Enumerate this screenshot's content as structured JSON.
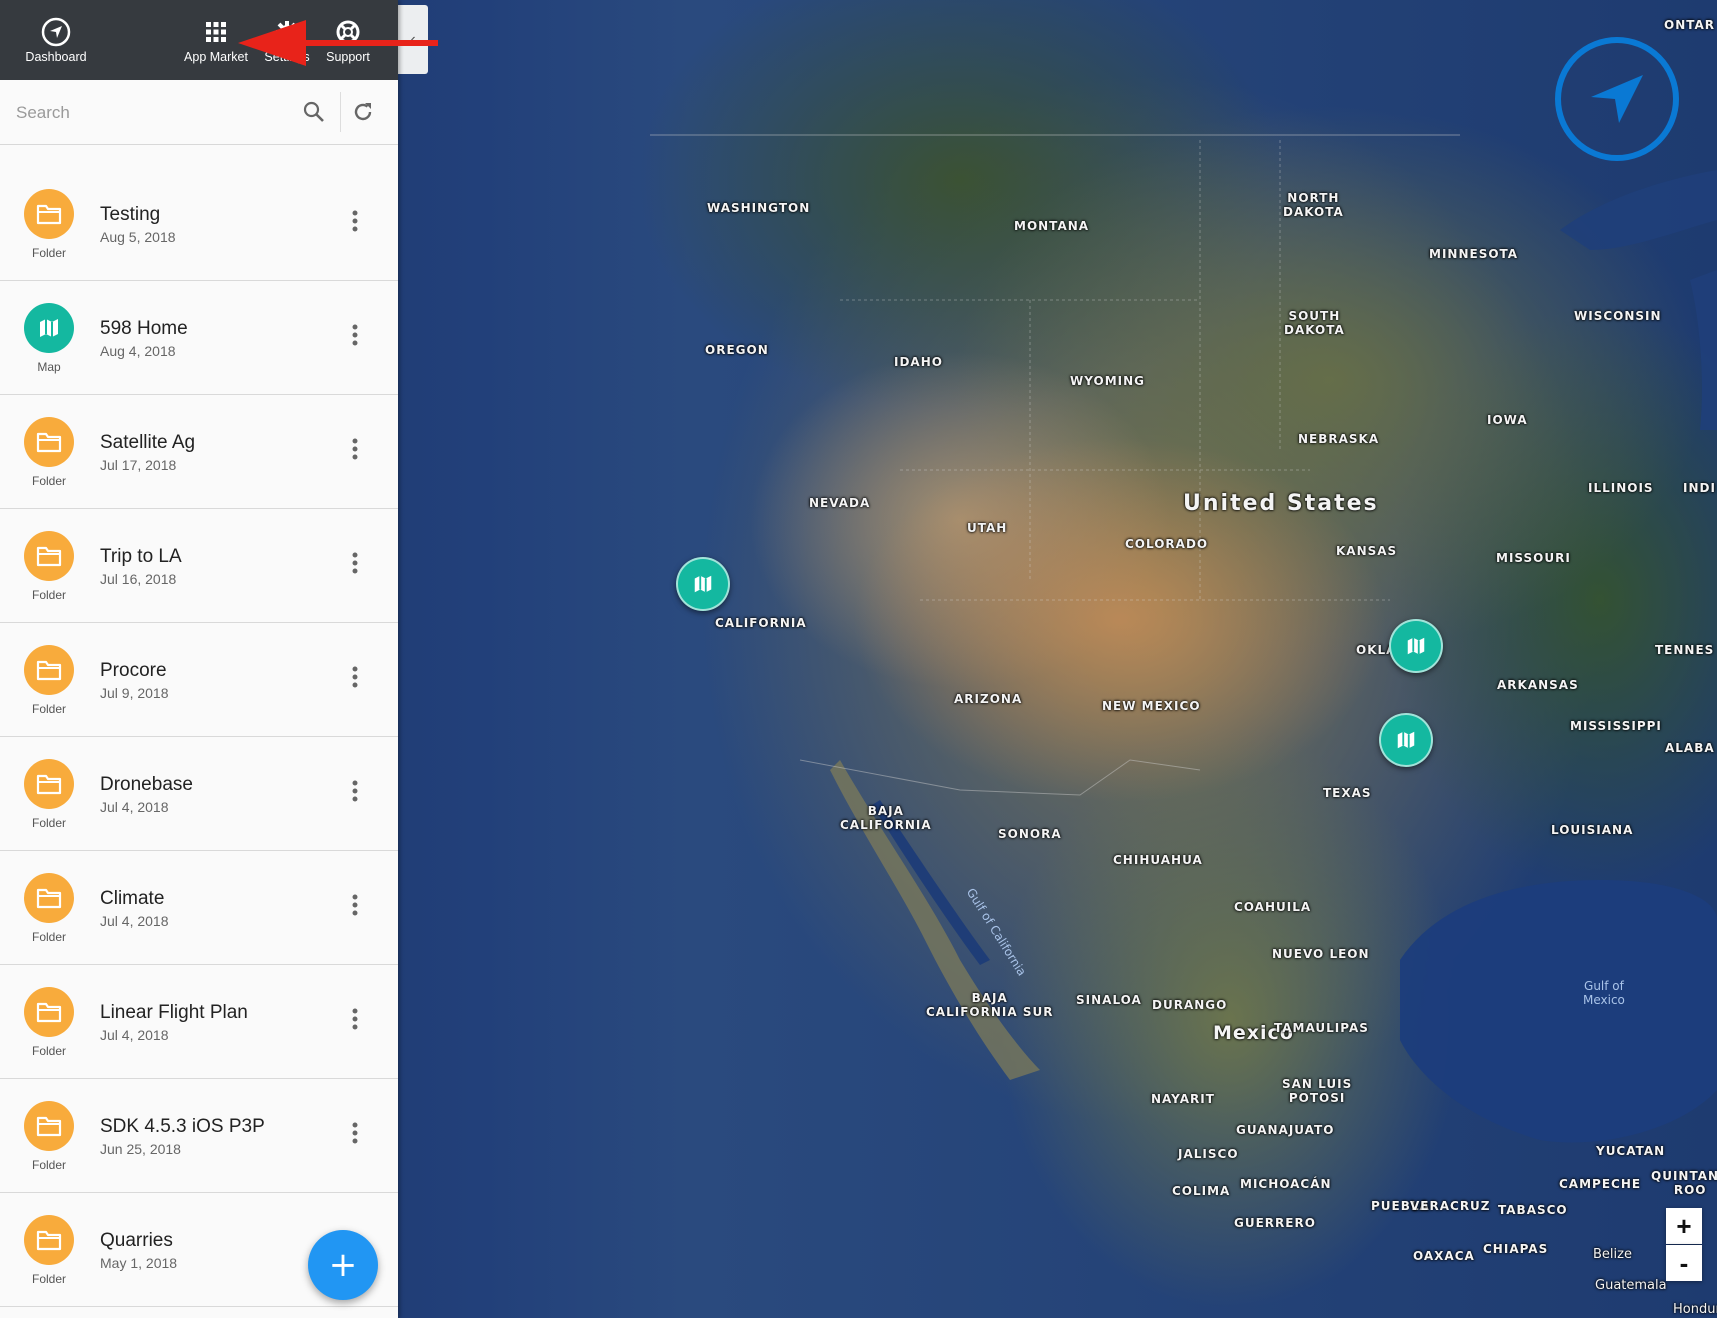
{
  "nav": {
    "dashboard_label": "Dashboard",
    "app_market_label": "App Market",
    "settings_label": "Settings",
    "support_label": "Support"
  },
  "search": {
    "placeholder": "Search",
    "value": ""
  },
  "items": [
    {
      "name": "Testing",
      "date": "Aug 5, 2018",
      "type": "Folder"
    },
    {
      "name": "598 Home",
      "date": "Aug 4, 2018",
      "type": "Map"
    },
    {
      "name": "Satellite Ag",
      "date": "Jul 17, 2018",
      "type": "Folder"
    },
    {
      "name": "Trip to LA",
      "date": "Jul 16, 2018",
      "type": "Folder"
    },
    {
      "name": "Procore",
      "date": "Jul 9, 2018",
      "type": "Folder"
    },
    {
      "name": "Dronebase",
      "date": "Jul 4, 2018",
      "type": "Folder"
    },
    {
      "name": "Climate",
      "date": "Jul 4, 2018",
      "type": "Folder"
    },
    {
      "name": "Linear Flight Plan",
      "date": "Jul 4, 2018",
      "type": "Folder"
    },
    {
      "name": "SDK 4.5.3 iOS P3P",
      "date": "Jun 25, 2018",
      "type": "Folder"
    },
    {
      "name": "Quarries",
      "date": "May 1, 2018",
      "type": "Folder"
    }
  ],
  "fab_label": "+",
  "collapse_label": "‹",
  "map": {
    "labels": {
      "ontario": "ONTAR",
      "washington": "WASHINGTON",
      "montana": "MONTANA",
      "north_dakota": "NORTH\nDAKOTA",
      "minnesota": "MINNESOTA",
      "south_dakota": "SOUTH\nDAKOTA",
      "wisconsin": "WISCONSIN",
      "oregon": "OREGON",
      "idaho": "IDAHO",
      "wyoming": "WYOMING",
      "nebraska": "NEBRASKA",
      "iowa": "IOWA",
      "illinois": "ILLINOIS",
      "indiana": "INDI",
      "nevada": "NEVADA",
      "utah": "UTAH",
      "united_states": "United States",
      "colorado": "COLORADO",
      "kansas": "KANSAS",
      "missouri": "MISSOURI",
      "california": "CALIFORNIA",
      "oklahoma": "OKLA    A",
      "tennessee": "TENNES",
      "arkansas": "ARKANSAS",
      "arizona": "ARIZONA",
      "new_mexico": "NEW MEXICO",
      "mississippi": "MISSISSIPPI",
      "alabama": "ALABA",
      "texas": "TEXAS",
      "baja_california": "BAJA\nCALIFORNIA",
      "sonora": "SONORA",
      "louisiana": "LOUISIANA",
      "chihuahua": "CHIHUAHUA",
      "gulf_of_california": "Gulf of California",
      "coahuila": "COAHUILA",
      "nuevo_leon": "NUEVO LEON",
      "gulf_of_mexico": "Gulf of\nMexico",
      "baja_california_sur": "BAJA\nCALIFORNIA SUR",
      "sinaloa": "SINALOA",
      "durango": "DURANGO",
      "mexico": "Mexico",
      "tamaulipas": "TAMAULIPAS",
      "san_luis_potosi": "SAN LUIS\nPOTOSI",
      "nayarit": "NAYARIT",
      "guanajuato": "GUANAJUATO",
      "jalisco": "JALISCO",
      "yucatan": "YUCATAN",
      "campeche": "CAMPECHE",
      "quintana_roo": "QUINTANA\nROO",
      "colima": "COLIMA",
      "michoacan": "MICHOACÁN",
      "puebla": "PUEBLA",
      "veracruz": "VERACRUZ",
      "tabasco": "TABASCO",
      "guerrero": "GUERRERO",
      "oaxaca": "OAXACA",
      "chiapas": "CHIAPAS",
      "belize": "Belize",
      "guatemala": "Guatemala",
      "honduras": "Hondura"
    },
    "zoom_in_label": "+",
    "zoom_out_label": "-"
  },
  "colors": {
    "nav_bg": "#363a3f",
    "folder": "#f8ab3c",
    "map_item": "#14b8a0",
    "fab": "#2196f3",
    "compass": "#0a79d4",
    "annotation_arrow": "#e8231a"
  }
}
